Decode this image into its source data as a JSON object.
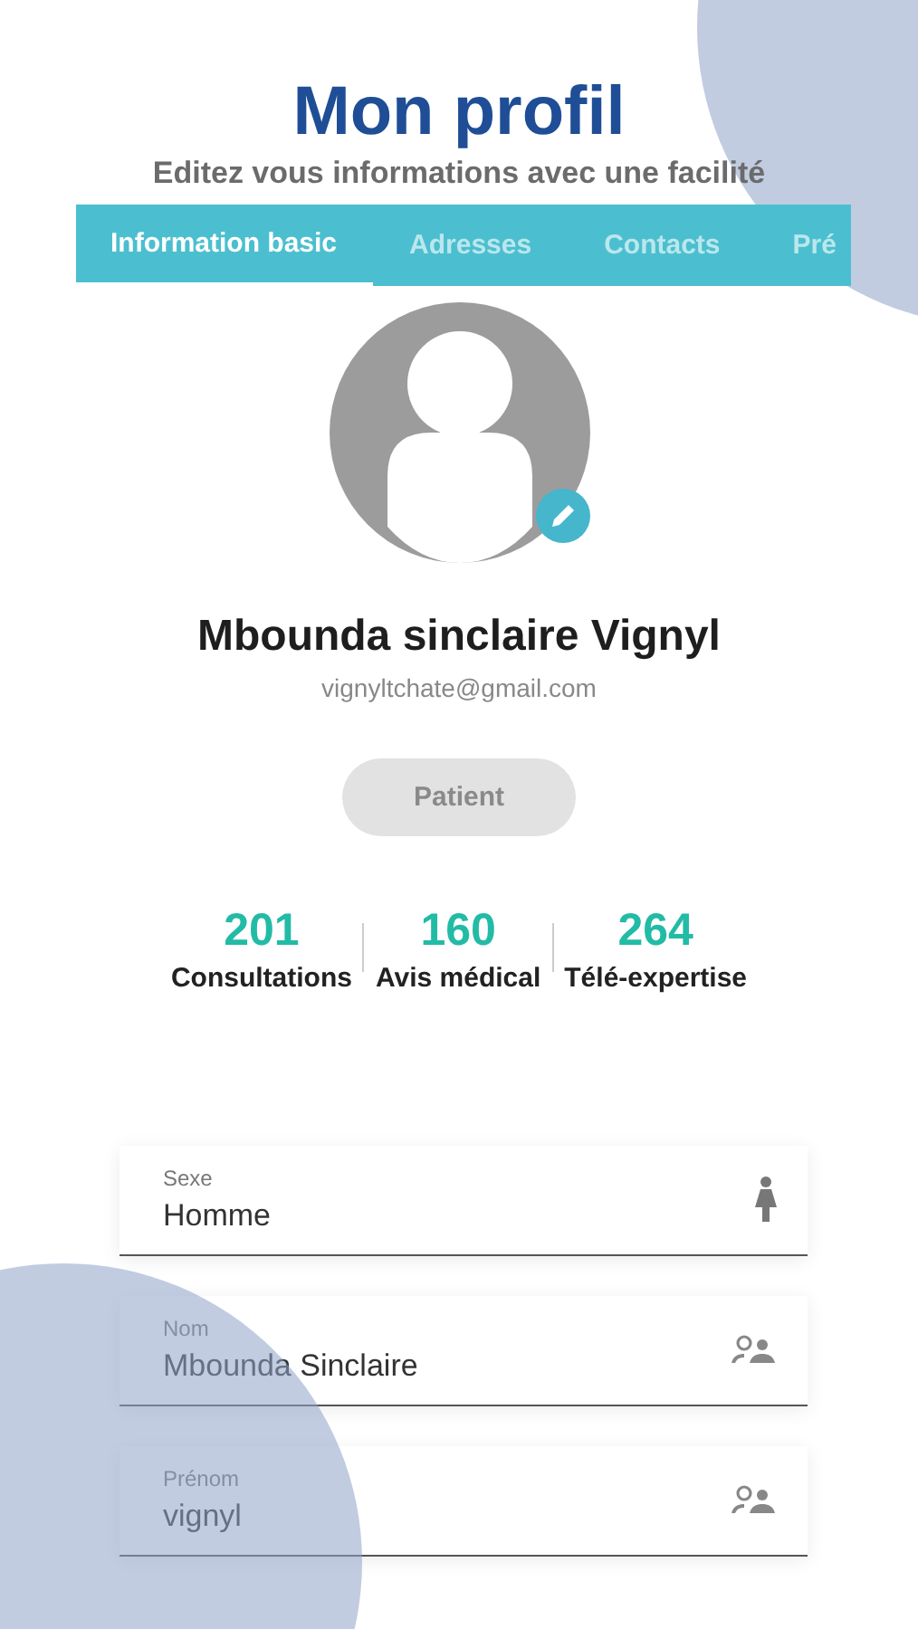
{
  "header": {
    "title": "Mon profil",
    "subtitle": "Editez vous informations avec une facilité"
  },
  "tabs": [
    {
      "label": "Information basic",
      "selected": true
    },
    {
      "label": "Adresses",
      "selected": false
    },
    {
      "label": "Contacts",
      "selected": false
    },
    {
      "label": "Pré",
      "selected": false
    }
  ],
  "profile": {
    "name": "Mbounda sinclaire Vignyl",
    "email": "vignyltchate@gmail.com",
    "role": "Patient"
  },
  "stats": [
    {
      "value": "201",
      "label": "Consultations"
    },
    {
      "value": "160",
      "label": "Avis médical"
    },
    {
      "value": "264",
      "label": "Télé-expertise"
    }
  ],
  "fields": [
    {
      "label": "Sexe",
      "value": "Homme",
      "kind": "gender"
    },
    {
      "label": "Nom",
      "value": "Mbounda Sinclaire",
      "kind": "person"
    },
    {
      "label": "Prénom",
      "value": "vignyl",
      "kind": "person"
    }
  ]
}
